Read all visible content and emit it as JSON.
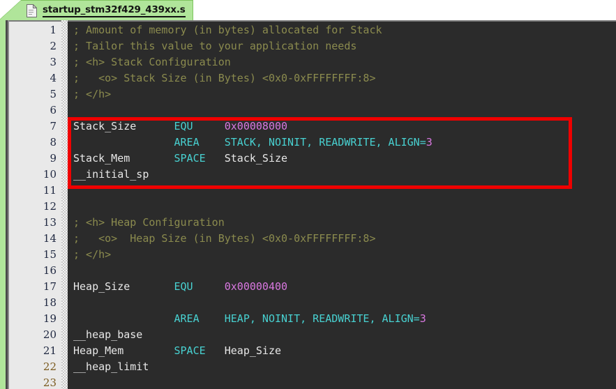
{
  "tab": {
    "filename": "startup_stm32f429_439xx.s",
    "icon": "document-icon",
    "active": true,
    "colors": {
      "tab_bg": "#b0e59a",
      "tab_border": "#7ec45f",
      "text": "#141414"
    }
  },
  "editor": {
    "theme": {
      "background": "#2b2b2b",
      "gutter_background": "#e9e9e9",
      "gutter_text": "#1e2740",
      "comment": "#8b8b4e",
      "identifier": "#e8e8e8",
      "keyword": "#48d1d1",
      "number": "#d978e0",
      "highlight_rect": "#ef0000"
    },
    "first_visible_line": 1,
    "last_visible_line": 23,
    "line_numbers": [
      1,
      2,
      3,
      4,
      5,
      6,
      7,
      8,
      9,
      10,
      11,
      12,
      13,
      14,
      15,
      16,
      17,
      18,
      19,
      20,
      21,
      22,
      23
    ],
    "lines": [
      {
        "n": 1,
        "tokens": [
          {
            "t": "comment",
            "s": "; Amount of memory (in bytes) allocated for Stack"
          }
        ]
      },
      {
        "n": 2,
        "tokens": [
          {
            "t": "comment",
            "s": "; Tailor this value to your application needs"
          }
        ]
      },
      {
        "n": 3,
        "tokens": [
          {
            "t": "comment",
            "s": "; <h> Stack Configuration"
          }
        ]
      },
      {
        "n": 4,
        "tokens": [
          {
            "t": "comment",
            "s": ";   <o> Stack Size (in Bytes) <0x0-0xFFFFFFFF:8>"
          }
        ]
      },
      {
        "n": 5,
        "tokens": [
          {
            "t": "comment",
            "s": "; </h>"
          }
        ]
      },
      {
        "n": 6,
        "tokens": []
      },
      {
        "n": 7,
        "tokens": [
          {
            "t": "ident",
            "s": "Stack_Size"
          },
          {
            "t": "plain",
            "s": "      "
          },
          {
            "t": "keyword",
            "s": "EQU"
          },
          {
            "t": "plain",
            "s": "     "
          },
          {
            "t": "number",
            "s": "0x00008000"
          }
        ]
      },
      {
        "n": 8,
        "tokens": [
          {
            "t": "plain",
            "s": "                "
          },
          {
            "t": "keyword",
            "s": "AREA"
          },
          {
            "t": "plain",
            "s": "    "
          },
          {
            "t": "keyword",
            "s": "STACK, NOINIT, READWRITE, ALIGN="
          },
          {
            "t": "number",
            "s": "3"
          }
        ]
      },
      {
        "n": 9,
        "tokens": [
          {
            "t": "ident",
            "s": "Stack_Mem"
          },
          {
            "t": "plain",
            "s": "       "
          },
          {
            "t": "keyword",
            "s": "SPACE"
          },
          {
            "t": "plain",
            "s": "   "
          },
          {
            "t": "ident",
            "s": "Stack_Size"
          }
        ]
      },
      {
        "n": 10,
        "tokens": [
          {
            "t": "ident",
            "s": "__initial_sp"
          }
        ]
      },
      {
        "n": 11,
        "tokens": []
      },
      {
        "n": 12,
        "tokens": []
      },
      {
        "n": 13,
        "tokens": [
          {
            "t": "comment",
            "s": "; <h> Heap Configuration"
          }
        ]
      },
      {
        "n": 14,
        "tokens": [
          {
            "t": "comment",
            "s": ";   <o>  Heap Size (in Bytes) <0x0-0xFFFFFFFF:8>"
          }
        ]
      },
      {
        "n": 15,
        "tokens": [
          {
            "t": "comment",
            "s": "; </h>"
          }
        ]
      },
      {
        "n": 16,
        "tokens": []
      },
      {
        "n": 17,
        "tokens": [
          {
            "t": "ident",
            "s": "Heap_Size"
          },
          {
            "t": "plain",
            "s": "       "
          },
          {
            "t": "keyword",
            "s": "EQU"
          },
          {
            "t": "plain",
            "s": "     "
          },
          {
            "t": "number",
            "s": "0x00000400"
          }
        ]
      },
      {
        "n": 18,
        "tokens": []
      },
      {
        "n": 19,
        "tokens": [
          {
            "t": "plain",
            "s": "                "
          },
          {
            "t": "keyword",
            "s": "AREA"
          },
          {
            "t": "plain",
            "s": "    "
          },
          {
            "t": "keyword",
            "s": "HEAP, NOINIT, READWRITE, ALIGN="
          },
          {
            "t": "number",
            "s": "3"
          }
        ]
      },
      {
        "n": 20,
        "tokens": [
          {
            "t": "ident",
            "s": "__heap_base"
          }
        ]
      },
      {
        "n": 21,
        "tokens": [
          {
            "t": "ident",
            "s": "Heap_Mem"
          },
          {
            "t": "plain",
            "s": "        "
          },
          {
            "t": "keyword",
            "s": "SPACE"
          },
          {
            "t": "plain",
            "s": "   "
          },
          {
            "t": "ident",
            "s": "Heap_Size"
          }
        ]
      },
      {
        "n": 22,
        "tokens": [
          {
            "t": "ident",
            "s": "__heap_limit"
          }
        ]
      },
      {
        "n": 23,
        "tokens": []
      }
    ]
  },
  "annotation": {
    "type": "highlight-rectangle",
    "color": "#ef0000",
    "covers_lines": "7-10",
    "label": "stack-configuration-highlight"
  }
}
